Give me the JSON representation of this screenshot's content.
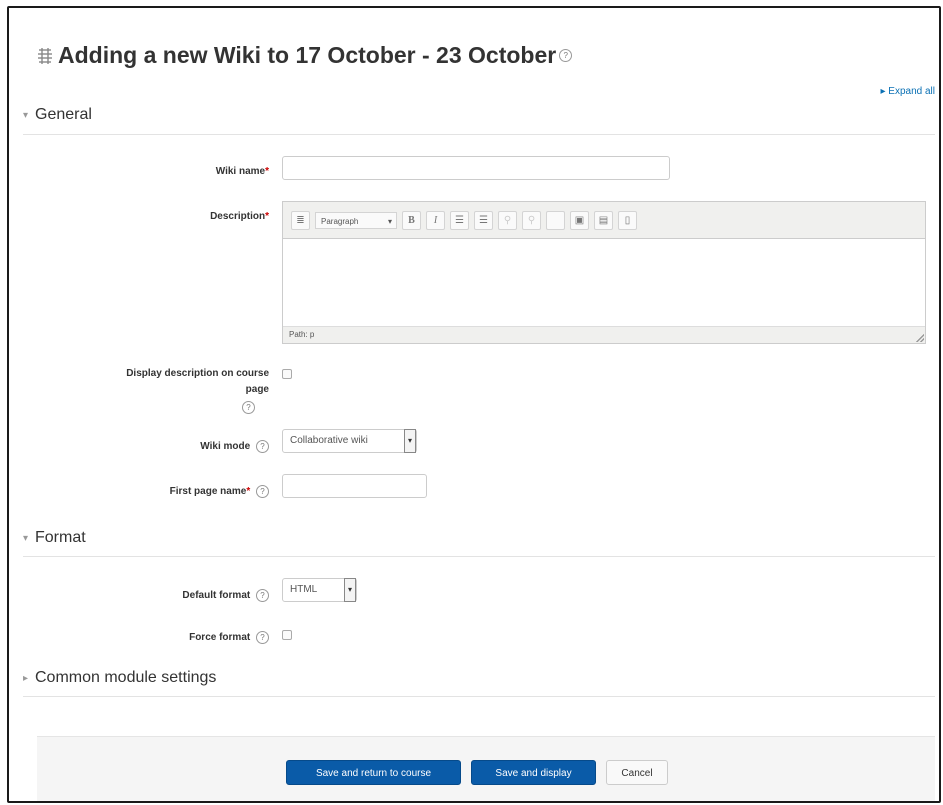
{
  "header": {
    "title": "Adding a new Wiki to 17 October - 23 October",
    "expand_all": "▸ Expand all"
  },
  "sections": {
    "general": "General",
    "format": "Format",
    "common": "Common module settings"
  },
  "fields": {
    "wiki_name_label": "Wiki name",
    "wiki_name_value": "",
    "description_label": "Description",
    "display_description_label_line1": "Display description on course",
    "display_description_label_line2": "page",
    "wiki_mode_label": "Wiki mode",
    "wiki_mode_value": "Collaborative wiki",
    "first_page_name_label": "First page name",
    "first_page_name_value": "",
    "default_format_label": "Default format",
    "default_format_value": "HTML",
    "force_format_label": "Force format",
    "required_marker": "*"
  },
  "editor": {
    "paragraph_label": "Paragraph",
    "path_text": "Path: p",
    "toolbar_icons": [
      "toolbar-toggle-icon",
      "bold-icon",
      "italic-icon",
      "unordered-list-icon",
      "ordered-list-icon",
      "link-icon",
      "unlink-icon",
      "blank-icon",
      "image-icon",
      "media-icon",
      "manage-files-icon"
    ]
  },
  "buttons": {
    "save_return": "Save and return to course",
    "save_display": "Save and display",
    "cancel": "Cancel"
  },
  "colors": {
    "primary_button": "#0a5ba8",
    "link": "#0a70b4",
    "required": "#cc0000"
  }
}
